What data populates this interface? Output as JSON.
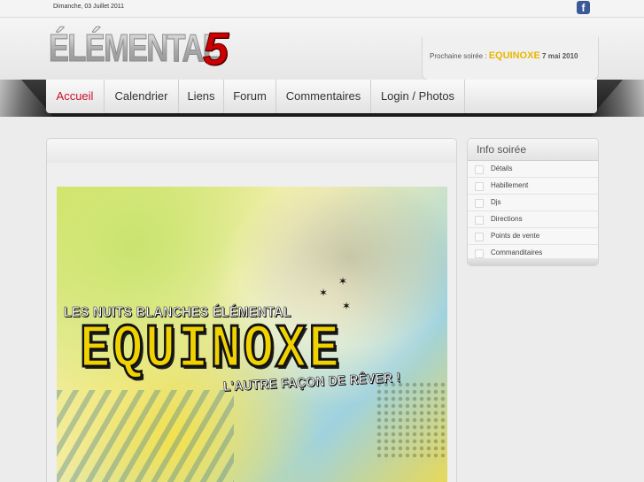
{
  "topbar": {
    "date": "Dimanche, 03 Juillet 2011",
    "facebook_icon": "facebook-icon"
  },
  "logo": {
    "text": "ÉLÉMENTAL",
    "number": "5"
  },
  "next_event": {
    "label": "Prochaine soirée :",
    "name": "EQUINOXE",
    "date": "7 mai 2010",
    "accent_color": "#e9b600"
  },
  "nav": {
    "items": [
      {
        "label": "Accueil",
        "active": true
      },
      {
        "label": "Calendrier"
      },
      {
        "label": "Liens"
      },
      {
        "label": "Forum"
      },
      {
        "label": "Commentaires"
      },
      {
        "label": "Login / Photos"
      }
    ],
    "active_color": "#c8102e"
  },
  "poster": {
    "line1": "LES NUITS BLANCHES ÉLÉMENTAL",
    "title": "EQUINOXE",
    "line2": "L'AUTRE FAÇON DE RÊVER !"
  },
  "sidebar": {
    "title": "Info soirée",
    "items": [
      {
        "label": "Détails"
      },
      {
        "label": "Habillement"
      },
      {
        "label": "Djs"
      },
      {
        "label": "Directions"
      },
      {
        "label": "Points de vente"
      },
      {
        "label": "Commanditaires"
      }
    ]
  }
}
